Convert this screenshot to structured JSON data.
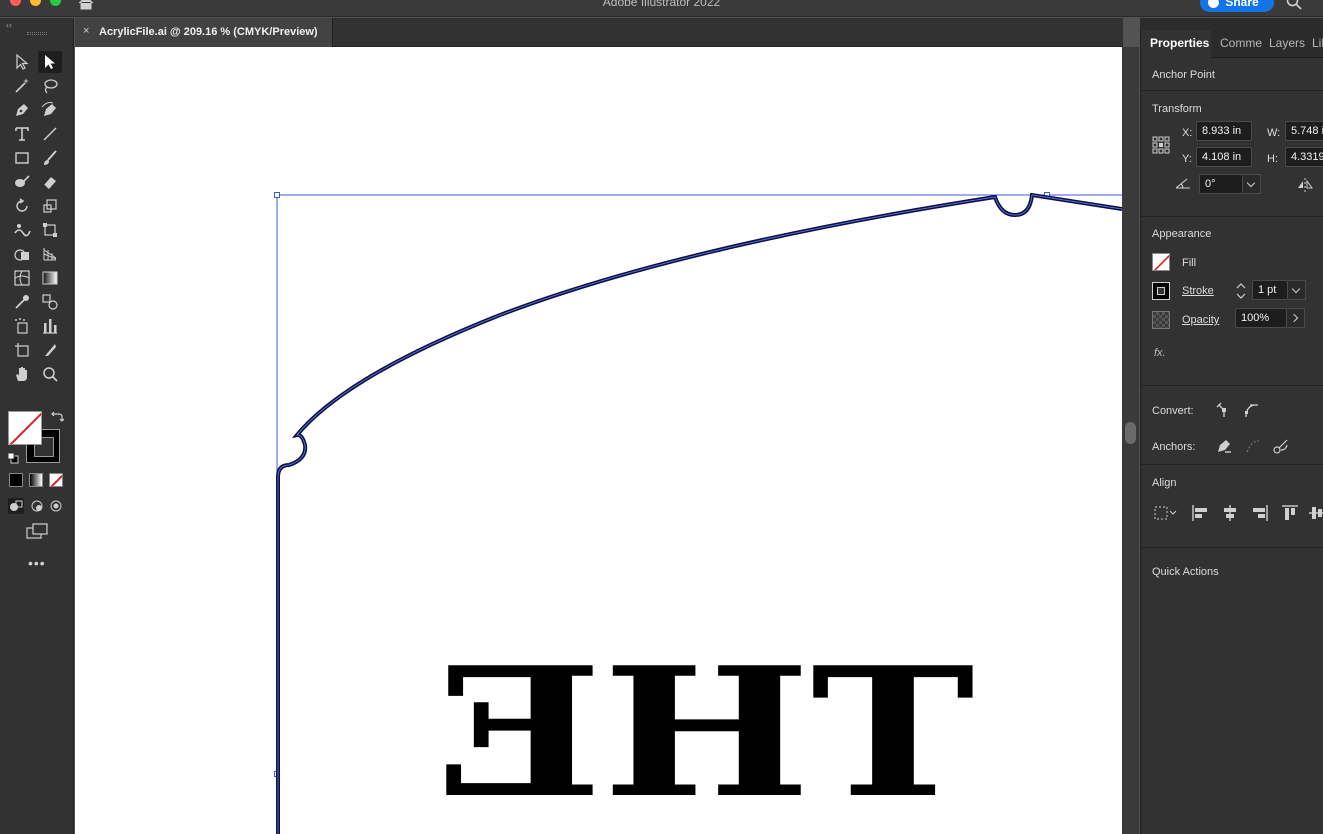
{
  "window": {
    "app_title": "Adobe Illustrator 2022",
    "share_label": "Share"
  },
  "document": {
    "tab_title": "AcrylicFile.ai @ 209.16 % (CMYK/Preview)",
    "close_glyph": "×"
  },
  "artwork": {
    "text": "THE",
    "mirrored": true,
    "stroke_color": "#0b1040",
    "selection_color": "#3b5bdb"
  },
  "tools": [
    "selection-tool",
    "direct-selection-tool",
    "magic-wand-tool",
    "lasso-tool",
    "pen-tool",
    "curvature-tool",
    "type-tool",
    "line-segment-tool",
    "rectangle-tool",
    "paintbrush-tool",
    "shaper-tool",
    "eraser-tool",
    "rotate-tool",
    "scale-tool",
    "warp-tool",
    "free-transform-tool",
    "shape-builder-tool",
    "perspective-grid-tool",
    "mesh-tool",
    "gradient-tool",
    "eyedropper-tool",
    "blend-tool",
    "symbol-sprayer-tool",
    "column-graph-tool",
    "artboard-tool",
    "slice-tool",
    "hand-tool",
    "zoom-tool"
  ],
  "toolbar": {
    "more_label": "•••",
    "collapse_label": "‹‹"
  },
  "panel": {
    "tabs": [
      "Properties",
      "Comme",
      "Layers",
      "Lib"
    ],
    "selection_type": "Anchor Point",
    "transform": {
      "title": "Transform",
      "x_label": "X:",
      "x_value": "8.933 in",
      "y_label": "Y:",
      "y_value": "4.108 in",
      "w_label": "W:",
      "w_value": "5.748 i",
      "h_label": "H:",
      "h_value": "4.3319",
      "angle_value": "0°"
    },
    "appearance": {
      "title": "Appearance",
      "fill_label": "Fill",
      "stroke_label": "Stroke",
      "stroke_weight": "1 pt",
      "opacity_label": "Opacity",
      "opacity_value": "100%",
      "fx_label": "fx."
    },
    "convert_label": "Convert:",
    "anchors_label": "Anchors:",
    "align_title": "Align",
    "quick_actions_title": "Quick Actions"
  },
  "colors": {
    "accent": "#1473e6",
    "chrome_dark": "#323232",
    "canvas": "#ffffff"
  }
}
